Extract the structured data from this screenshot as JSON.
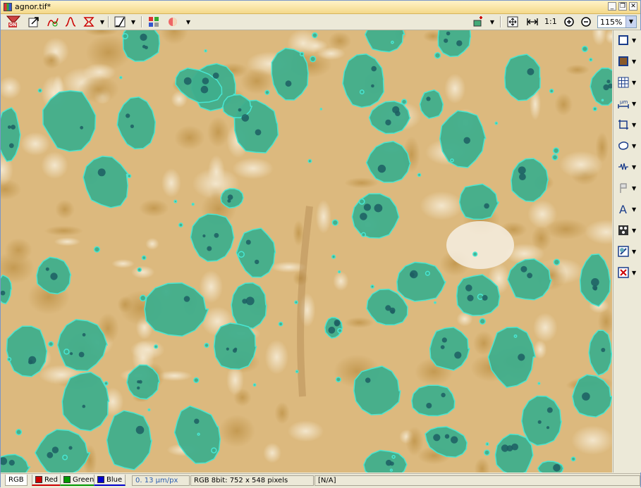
{
  "window": {
    "title": "agnor.tif*"
  },
  "toolbar": {
    "on_label": "ON",
    "actual_size_label": "1:1",
    "zoom_value": "115%"
  },
  "status": {
    "tabs": [
      "RGB",
      "Red",
      "Green",
      "Blue"
    ],
    "scale": "0. 13 µm/px",
    "image_info": "RGB 8bit: 752 x 548 pixels",
    "value": "[N/A]"
  },
  "right_toolbar": {
    "items": [
      "rectangle-tool",
      "fill-tool",
      "grid-tool",
      "measure-tool",
      "crop-tool",
      "ellipse-tool",
      "line-profile-tool",
      "marker-tool",
      "text-tool",
      "color-picker-tool",
      "roi-tool",
      "clear-overlay-tool"
    ]
  },
  "colors": {
    "background_tissue": "#d9b67a",
    "nucleus_fill": "#3fae8c",
    "nucleus_outline": "#49e6d2",
    "nucleolus": "#1d5e63"
  }
}
